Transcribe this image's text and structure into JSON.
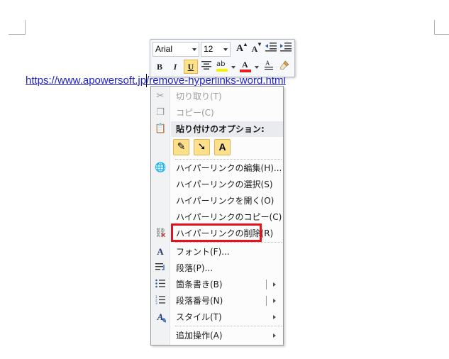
{
  "document": {
    "link_text": "https://www.apowersoft.jp/remove-hyperlinks-word.html"
  },
  "mini_toolbar": {
    "font_name": "Arial",
    "font_size": "12",
    "grow_font_icon": "A",
    "shrink_font_icon": "A",
    "bold_label": "B",
    "italic_label": "I",
    "underline_label": "U",
    "underline_active": true,
    "highlight_icon_text": "ab",
    "font_color_icon_text": "A",
    "format_painter_icon": "brush-icon"
  },
  "context_menu": {
    "items": [
      {
        "label": "切り取り(T)",
        "icon": "scissors-icon",
        "disabled": true
      },
      {
        "label": "コピー(C)",
        "icon": "copy-icon",
        "disabled": true
      },
      {
        "label": "貼り付けのオプション:",
        "icon": "paste-icon",
        "section": true
      },
      {
        "label": "ハイパーリンクの編集(H)...",
        "icon": "globe-link-icon"
      },
      {
        "label": "ハイパーリンクの選択(S)"
      },
      {
        "label": "ハイパーリンクを開く(O)"
      },
      {
        "label": "ハイパーリンクのコピー(C)"
      },
      {
        "label": "ハイパーリンクの削除(R)",
        "icon": "remove-link-icon",
        "highlighted": true
      },
      {
        "label": "フォント(F)...",
        "icon": "font-icon"
      },
      {
        "label": "段落(P)...",
        "icon": "paragraph-icon"
      },
      {
        "label": "箇条書き(B)",
        "icon": "bullets-icon",
        "submenu": true
      },
      {
        "label": "段落番号(N)",
        "icon": "numbering-icon",
        "submenu": true
      },
      {
        "label": "スタイル(T)",
        "icon": "styles-icon",
        "submenu": true
      },
      {
        "label": "追加操作(A)",
        "submenu": true
      }
    ],
    "paste_options": [
      {
        "icon": "keep-source-formatting-icon",
        "glyph": "✎"
      },
      {
        "icon": "merge-formatting-icon",
        "glyph": "➘"
      },
      {
        "icon": "keep-text-only-icon",
        "glyph": "A"
      }
    ]
  },
  "colors": {
    "link": "#1f1fcf",
    "highlight_frame": "#e8101d",
    "active_button": "#fde289",
    "highlighter_yellow": "#f7f300",
    "font_color_red": "#e02020"
  }
}
